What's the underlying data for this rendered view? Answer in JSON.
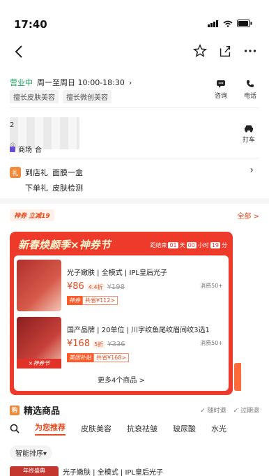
{
  "status_bar": {
    "time": "17:40"
  },
  "store": {
    "status": "营业中",
    "hours": "周一至周日 10:00-18:30",
    "tags": [
      "擅长皮肤美容",
      "擅长微创美容"
    ],
    "actions": [
      {
        "label": "咨询",
        "icon": "chat-icon"
      },
      {
        "label": "电话",
        "icon": "phone-icon"
      }
    ],
    "address_prefix": "2",
    "mall_label": "商场",
    "mall_suffix": "合",
    "taxi_label": "打车"
  },
  "gifts": [
    {
      "badge": "礼",
      "type": "到店礼",
      "content": "面膜一盒"
    },
    {
      "type": "下单礼",
      "content": "皮肤检测"
    }
  ],
  "coupon": {
    "badge": "神券 立减19",
    "all_label": "全部 >"
  },
  "promo": {
    "title": "新春焕颜季×神券节",
    "countdown_prefix": "距结束",
    "countdown_days": "01",
    "countdown_day_unit": "天",
    "countdown_hours": "00",
    "countdown_hour_unit": "小时",
    "countdown_mins": "19",
    "countdown_min_unit": "分",
    "more_label": "更多4个商品 >"
  },
  "products": [
    {
      "name": "光子嫩肤 | 全模式 | IPL皇后光子",
      "price": "¥86",
      "discount": "4.4折",
      "original": "¥198",
      "tag1": "神券",
      "tag2": "共省¥112>",
      "sales": "消费50+"
    },
    {
      "name": "国产品牌 | 20单位 | 川字纹鱼尾纹眉间纹3选1",
      "price": "¥168",
      "discount": "5折",
      "original": "¥336",
      "tag1": "美团补贴",
      "tag2": "共省¥168>",
      "sales": "消费50+",
      "ribbon": "×神券节"
    }
  ],
  "section": {
    "badge": "购",
    "title": "精选商品",
    "flags": [
      "随时退",
      "过期退"
    ]
  },
  "tabs": [
    "为您推荐",
    "皮肤美容",
    "抗衰祛皱",
    "玻尿酸",
    "水光"
  ],
  "sort_label": "智能排序▾",
  "bottom_item": {
    "name": "光子嫩肤 | 全模式 | IPL皇后光子",
    "img_text": "年终盛典"
  },
  "colors": {
    "accent": "#e54a1e",
    "promo_bg": "#ee3a2a",
    "open_green": "#1aa05a"
  }
}
